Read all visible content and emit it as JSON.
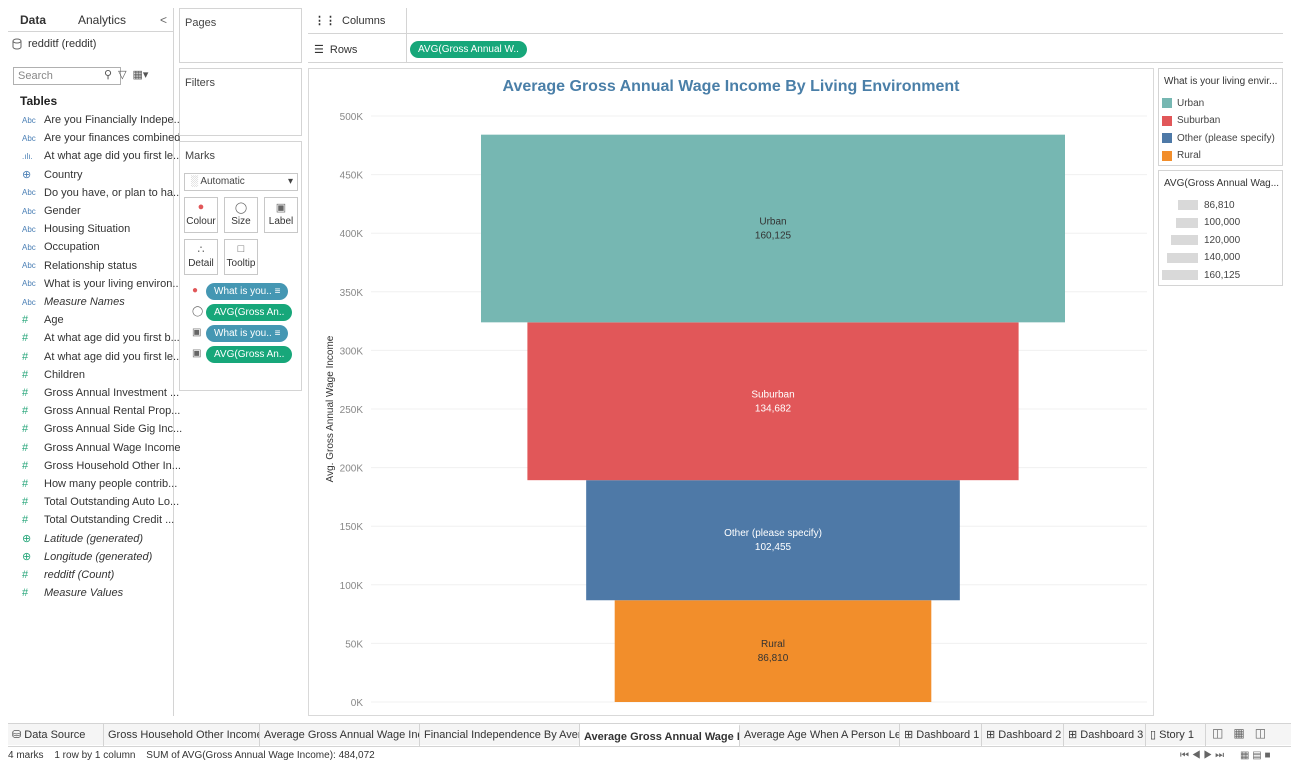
{
  "data_pane": {
    "tab_data": "Data",
    "tab_analytics": "Analytics",
    "collapse_glyph": "<",
    "datasource": "redditf (reddit)",
    "search_placeholder": "Search",
    "tables_label": "Tables",
    "dimensions": [
      {
        "type": "Abc",
        "name": "Are you Financially Indepe..."
      },
      {
        "type": "Abc",
        "name": "Are your finances combined"
      },
      {
        "type": ".ılı.",
        "name": "At what age did you first le..."
      },
      {
        "type": "globe",
        "name": "Country"
      },
      {
        "type": "Abc",
        "name": "Do you have, or plan to ha..."
      },
      {
        "type": "Abc",
        "name": "Gender"
      },
      {
        "type": "Abc",
        "name": "Housing Situation"
      },
      {
        "type": "Abc",
        "name": "Occupation"
      },
      {
        "type": "Abc",
        "name": "Relationship status"
      },
      {
        "type": "Abc",
        "name": "What is your living environ..."
      },
      {
        "type": "Abc",
        "name": "Measure Names",
        "italic": true
      }
    ],
    "measures": [
      {
        "type": "#",
        "name": "Age"
      },
      {
        "type": "#",
        "name": "At what age did you first b..."
      },
      {
        "type": "#",
        "name": "At what age did you first le..."
      },
      {
        "type": "#",
        "name": "Children"
      },
      {
        "type": "#",
        "name": "Gross Annual Investment ..."
      },
      {
        "type": "#",
        "name": "Gross Annual Rental Prop..."
      },
      {
        "type": "#",
        "name": "Gross Annual Side Gig Inc..."
      },
      {
        "type": "#",
        "name": "Gross Annual Wage Income"
      },
      {
        "type": "#",
        "name": "Gross Household Other In..."
      },
      {
        "type": "#",
        "name": "How many people contrib..."
      },
      {
        "type": "#",
        "name": "Total Outstanding Auto Lo..."
      },
      {
        "type": "#",
        "name": "Total Outstanding Credit ..."
      },
      {
        "type": "globe",
        "name": "Latitude (generated)",
        "italic": true
      },
      {
        "type": "globe",
        "name": "Longitude (generated)",
        "italic": true
      },
      {
        "type": "#",
        "name": "redditf (Count)",
        "italic": true
      },
      {
        "type": "#",
        "name": "Measure Values",
        "italic": true
      }
    ]
  },
  "shelves": {
    "pages": "Pages",
    "filters": "Filters",
    "columns": "Columns",
    "rows": "Rows",
    "rows_pill": "AVG(Gross Annual W.."
  },
  "marks": {
    "title": "Marks",
    "type": "Automatic",
    "colour": "Colour",
    "size": "Size",
    "label": "Label",
    "detail": "Detail",
    "tooltip": "Tooltip",
    "pills": [
      {
        "label": "What is you..",
        "color": "blue"
      },
      {
        "label": "AVG(Gross An..",
        "color": "green"
      },
      {
        "label": "What is you..",
        "color": "blue"
      },
      {
        "label": "AVG(Gross An..",
        "color": "green"
      }
    ]
  },
  "chart_data": {
    "type": "bar",
    "title": "Average Gross Annual Wage Income By Living Environment",
    "ylabel": "Avg. Gross Annual Wage Income",
    "ylim": [
      0,
      500000
    ],
    "yticks": [
      0,
      50000,
      100000,
      150000,
      200000,
      250000,
      300000,
      350000,
      400000,
      450000,
      500000
    ],
    "ytick_labels": [
      "0K",
      "50K",
      "100K",
      "150K",
      "200K",
      "250K",
      "300K",
      "350K",
      "400K",
      "450K",
      "500K"
    ],
    "categories": [
      "Urban",
      "Suburban",
      "Other (please specify)",
      "Rural"
    ],
    "values": [
      160125,
      134682,
      102455,
      86810
    ],
    "value_labels": [
      "160,125",
      "134,682",
      "102,455",
      "86,810"
    ],
    "colors": [
      "#76b7b2",
      "#e15759",
      "#4e79a7",
      "#f28e2b"
    ],
    "label_colors": [
      "#333333",
      "#ffffff",
      "#ffffff",
      "#333333"
    ],
    "stacked": true
  },
  "legend_color": {
    "title": "What is your living envir...",
    "items": [
      {
        "label": "Urban",
        "color": "#76b7b2"
      },
      {
        "label": "Suburban",
        "color": "#e15759"
      },
      {
        "label": "Other (please specify)",
        "color": "#4e79a7"
      },
      {
        "label": "Rural",
        "color": "#f28e2b"
      }
    ]
  },
  "legend_size": {
    "title": "AVG(Gross Annual Wag...",
    "items": [
      {
        "label": "86,810",
        "value": 86810
      },
      {
        "label": "100,000",
        "value": 100000
      },
      {
        "label": "120,000",
        "value": 120000
      },
      {
        "label": "140,000",
        "value": 140000
      },
      {
        "label": "160,125",
        "value": 160125
      }
    ]
  },
  "tabs": [
    {
      "label": "Data Source",
      "icon": "db"
    },
    {
      "label": "Gross Household Other Income ..."
    },
    {
      "label": "Average Gross Annual Wage Inc..."
    },
    {
      "label": "Financial Independence By Aver..."
    },
    {
      "label": "Average Gross Annual Wage In...",
      "active": true
    },
    {
      "label": "Average Age When A Person Le..."
    },
    {
      "label": "Dashboard 1",
      "icon": "grid"
    },
    {
      "label": "Dashboard 2",
      "icon": "grid"
    },
    {
      "label": "Dashboard 3",
      "icon": "grid"
    },
    {
      "label": "Story 1",
      "icon": "book"
    }
  ],
  "status": {
    "marks": "4 marks",
    "rows": "1 row by 1 column",
    "sum": "SUM of AVG(Gross Annual Wage Income): 484,072"
  }
}
